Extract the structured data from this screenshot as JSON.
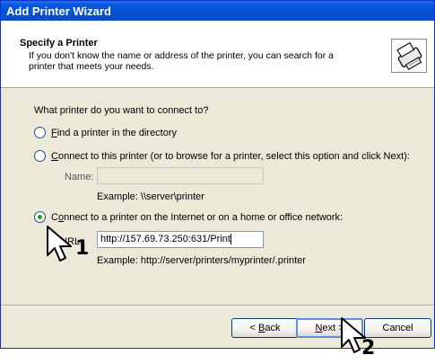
{
  "window": {
    "title": "Add Printer Wizard"
  },
  "header": {
    "title": "Specify a Printer",
    "description": "If you don't know the name or address of the printer, you can search for a printer that meets your needs.",
    "icon": "printer-wizard-icon"
  },
  "content": {
    "question": "What printer do you want to connect to?",
    "options": [
      {
        "prefix": "",
        "mnemonic": "F",
        "rest": "ind a printer in the directory",
        "checked": false
      },
      {
        "prefix": "",
        "mnemonic": "C",
        "rest": "onnect to this printer (or to browse for a printer, select this option and click Next):",
        "checked": false
      },
      {
        "prefix": "C",
        "mnemonic": "o",
        "rest": "nnect to a printer on the Internet or on a home or office network:",
        "checked": true
      }
    ],
    "name_label": "Name:",
    "name_value": "",
    "name_example": "Example: \\\\server\\printer",
    "url_label": "URL:",
    "url_value": "http://157.69.73.250:631/Print",
    "url_example": "Example: http://server/printers/myprinter/.printer"
  },
  "buttons": {
    "back_prefix": "< ",
    "back_mnemonic": "B",
    "back_rest": "ack",
    "next_mnemonic": "N",
    "next_rest": "ext >",
    "cancel": "Cancel"
  },
  "callouts": {
    "one": "1",
    "two": "2"
  }
}
